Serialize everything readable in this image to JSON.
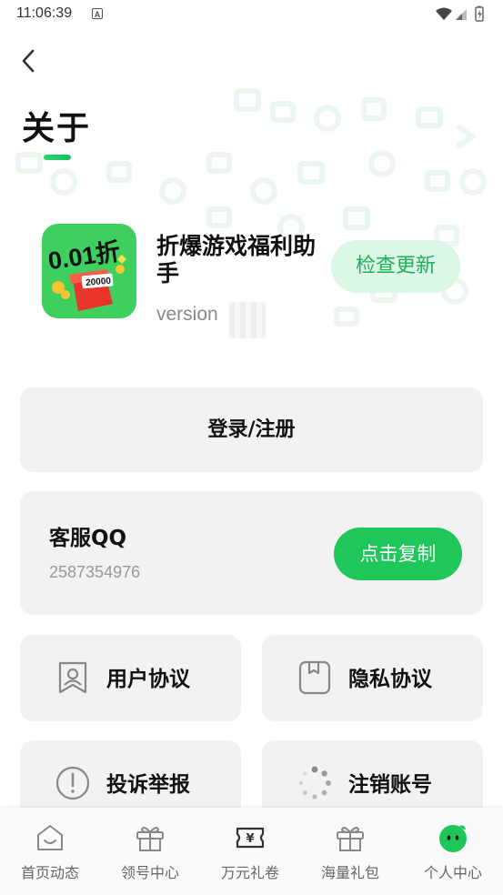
{
  "status_bar": {
    "time": "11:06:39",
    "notification_letter": "A"
  },
  "header": {
    "title": "关于"
  },
  "app_info": {
    "name": "折爆游戏福利助手",
    "version_label": "version",
    "check_update_label": "检查更新",
    "icon_text": "0.01折",
    "icon_sub_text": "20000"
  },
  "login": {
    "label": "登录/注册"
  },
  "customer_service": {
    "title": "客服QQ",
    "number": "2587354976",
    "copy_label": "点击复制"
  },
  "grid": {
    "user_agreement": "用户协议",
    "privacy_policy": "隐私协议",
    "report": "投诉举报",
    "delete_account": "注销账号"
  },
  "bottom_nav": {
    "items": [
      {
        "label": "首页动态",
        "icon": "home-icon"
      },
      {
        "label": "领号中心",
        "icon": "gift-icon"
      },
      {
        "label": "万元礼卷",
        "icon": "coupon-icon"
      },
      {
        "label": "海量礼包",
        "icon": "gift-icon"
      },
      {
        "label": "个人中心",
        "icon": "profile-icon"
      }
    ],
    "active_index": 4
  },
  "colors": {
    "accent": "#1fc65a",
    "accent_light": "#dbf7e5",
    "card_bg": "#f2f2f2"
  }
}
